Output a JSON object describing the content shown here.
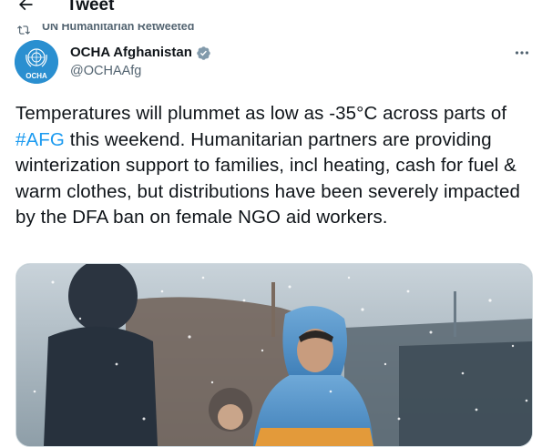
{
  "header": {
    "title": "Tweet",
    "back_icon": "arrow-left-icon"
  },
  "retweet": {
    "text": "UN Humanitarian Retweeted",
    "icon": "retweet-icon"
  },
  "author": {
    "name": "OCHA Afghanistan",
    "handle": "@OCHAAfg",
    "avatar_text": "OCHA",
    "verified": true,
    "avatar_color": "#2a8fd0"
  },
  "more_icon": "more-horizontal-icon",
  "tweet": {
    "text_before": "Temperatures will plummet as low as -35°C across parts of ",
    "hashtag": "#AFG",
    "text_after": " this weekend. Humanitarian partners are providing winterization support to families, incl heating, cash for fuel & warm clothes, but distributions have been severely impacted by the DFA ban on female NGO aid workers."
  },
  "media": {
    "type": "photo"
  },
  "colors": {
    "link": "#1d9bf0",
    "secondary_text": "#536471",
    "verified_badge": "#829aab"
  }
}
